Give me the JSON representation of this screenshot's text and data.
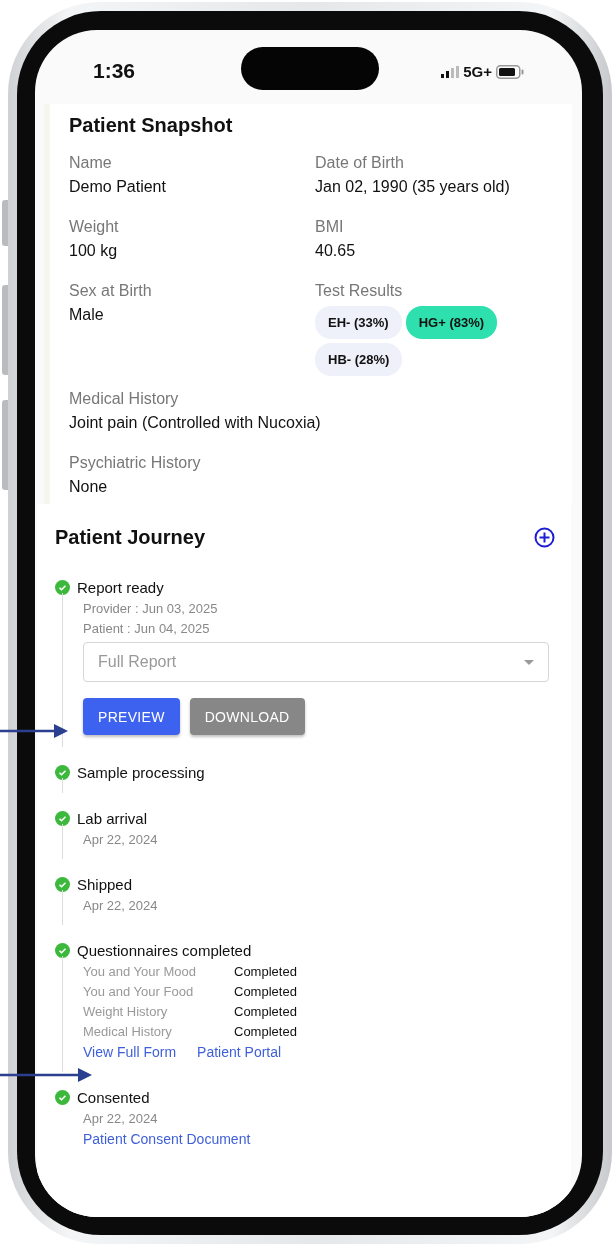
{
  "status_bar": {
    "time": "1:36",
    "network": "5G+"
  },
  "snapshot": {
    "title": "Patient Snapshot",
    "fields": [
      {
        "label": "Name",
        "value": "Demo Patient"
      },
      {
        "label": "Date of Birth",
        "value": "Jan 02, 1990 (35 years old)"
      },
      {
        "label": "Weight",
        "value": "100 kg"
      },
      {
        "label": "BMI",
        "value": "40.65"
      },
      {
        "label": "Sex at Birth",
        "value": "Male"
      },
      {
        "label": "Test Results",
        "kind": "chips",
        "chips": [
          {
            "label": "EH- (33%)",
            "color": "#eef0fa"
          },
          {
            "label": "HG+ (83%)",
            "color": "#2ee0ad"
          },
          {
            "label": "HB- (28%)",
            "color": "#eef0fa"
          }
        ]
      },
      {
        "label": "Medical History",
        "value": "Joint pain (Controlled with Nucoxia)",
        "kind": "wide"
      },
      {
        "label": "Psychiatric History",
        "value": "None",
        "kind": "wide"
      }
    ]
  },
  "journey": {
    "title": "Patient Journey",
    "events": [
      {
        "title": "Report ready",
        "completed": true,
        "dates": [
          "Provider : Jun 03, 2025",
          "Patient : Jun 04, 2025"
        ],
        "dropdown": {
          "placeholder": "Full Report"
        },
        "buttons": [
          {
            "label": "PREVIEW",
            "kind": "primary"
          },
          {
            "label": "DOWNLOAD",
            "kind": "secondary"
          }
        ]
      },
      {
        "title": "Sample processing",
        "completed": true
      },
      {
        "title": "Lab arrival",
        "completed": true,
        "dates": [
          "Apr 22, 2024"
        ]
      },
      {
        "title": "Shipped",
        "completed": true,
        "dates": [
          "Apr 22, 2024"
        ]
      },
      {
        "title": "Questionnaires completed",
        "completed": true,
        "questionnaires": [
          {
            "name": "You and Your Mood",
            "status": "Completed"
          },
          {
            "name": "You and Your Food",
            "status": "Completed"
          },
          {
            "name": "Weight History",
            "status": "Completed"
          },
          {
            "name": "Medical History",
            "status": "Completed"
          }
        ],
        "links": [
          "View Full Form",
          "Patient Portal"
        ]
      },
      {
        "title": "Consented",
        "completed": true,
        "dates": [
          "Apr 22, 2024"
        ],
        "links": [
          "Patient Consent Document"
        ]
      }
    ]
  }
}
